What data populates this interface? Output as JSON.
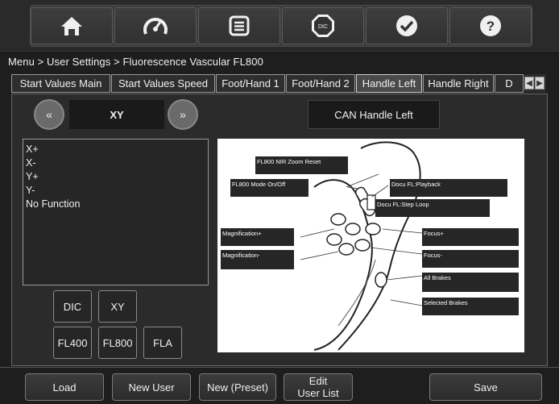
{
  "toolbar": {
    "icons": [
      "home-icon",
      "speedometer-icon",
      "list-icon",
      "dic-icon",
      "checkmark-icon",
      "help-icon"
    ],
    "dic_label": "DIC",
    "help_label": "?"
  },
  "breadcrumb": "Menu > User Settings > Fluorescence Vascular FL800",
  "tabs": [
    {
      "label": "Start Values Main",
      "active": false
    },
    {
      "label": "Start Values Speed",
      "active": false
    },
    {
      "label": "Foot/Hand 1",
      "active": false
    },
    {
      "label": "Foot/Hand 2",
      "active": false
    },
    {
      "label": "Handle Left",
      "active": true
    },
    {
      "label": "Handle Right",
      "active": false
    },
    {
      "label": "D",
      "active": false
    }
  ],
  "tab_scroll": {
    "left": "◀",
    "right": "▶"
  },
  "selector": {
    "prev_label": "«",
    "next_label": "»",
    "value": "XY"
  },
  "can_label": "CAN Handle Left",
  "functions": [
    "X+",
    "X-",
    "Y+",
    "Y-",
    "No Function"
  ],
  "mode_buttons": {
    "dic": "DIC",
    "xy": "XY",
    "fl400": "FL400",
    "fl800": "FL800",
    "fla": "FLA"
  },
  "diagram": {
    "labels": {
      "zoom_reset": "FL800 NIR Zoom Reset",
      "mode_onoff": "FL800 Mode On/Off",
      "playback": "Docu FL:Playback",
      "step_loop": "Docu FL:Step Loop",
      "mag_plus": "Magnification+",
      "mag_minus": "Magnification-",
      "focus_plus": "Focus+",
      "focus_minus": "Focus-",
      "all_brakes": "All Brakes",
      "selected_brakes": "Selected Brakes"
    }
  },
  "footer": {
    "load": "Load",
    "new_user": "New User",
    "new_preset": "New (Preset)",
    "edit_line1": "Edit",
    "edit_line2": "User List",
    "save": "Save"
  }
}
